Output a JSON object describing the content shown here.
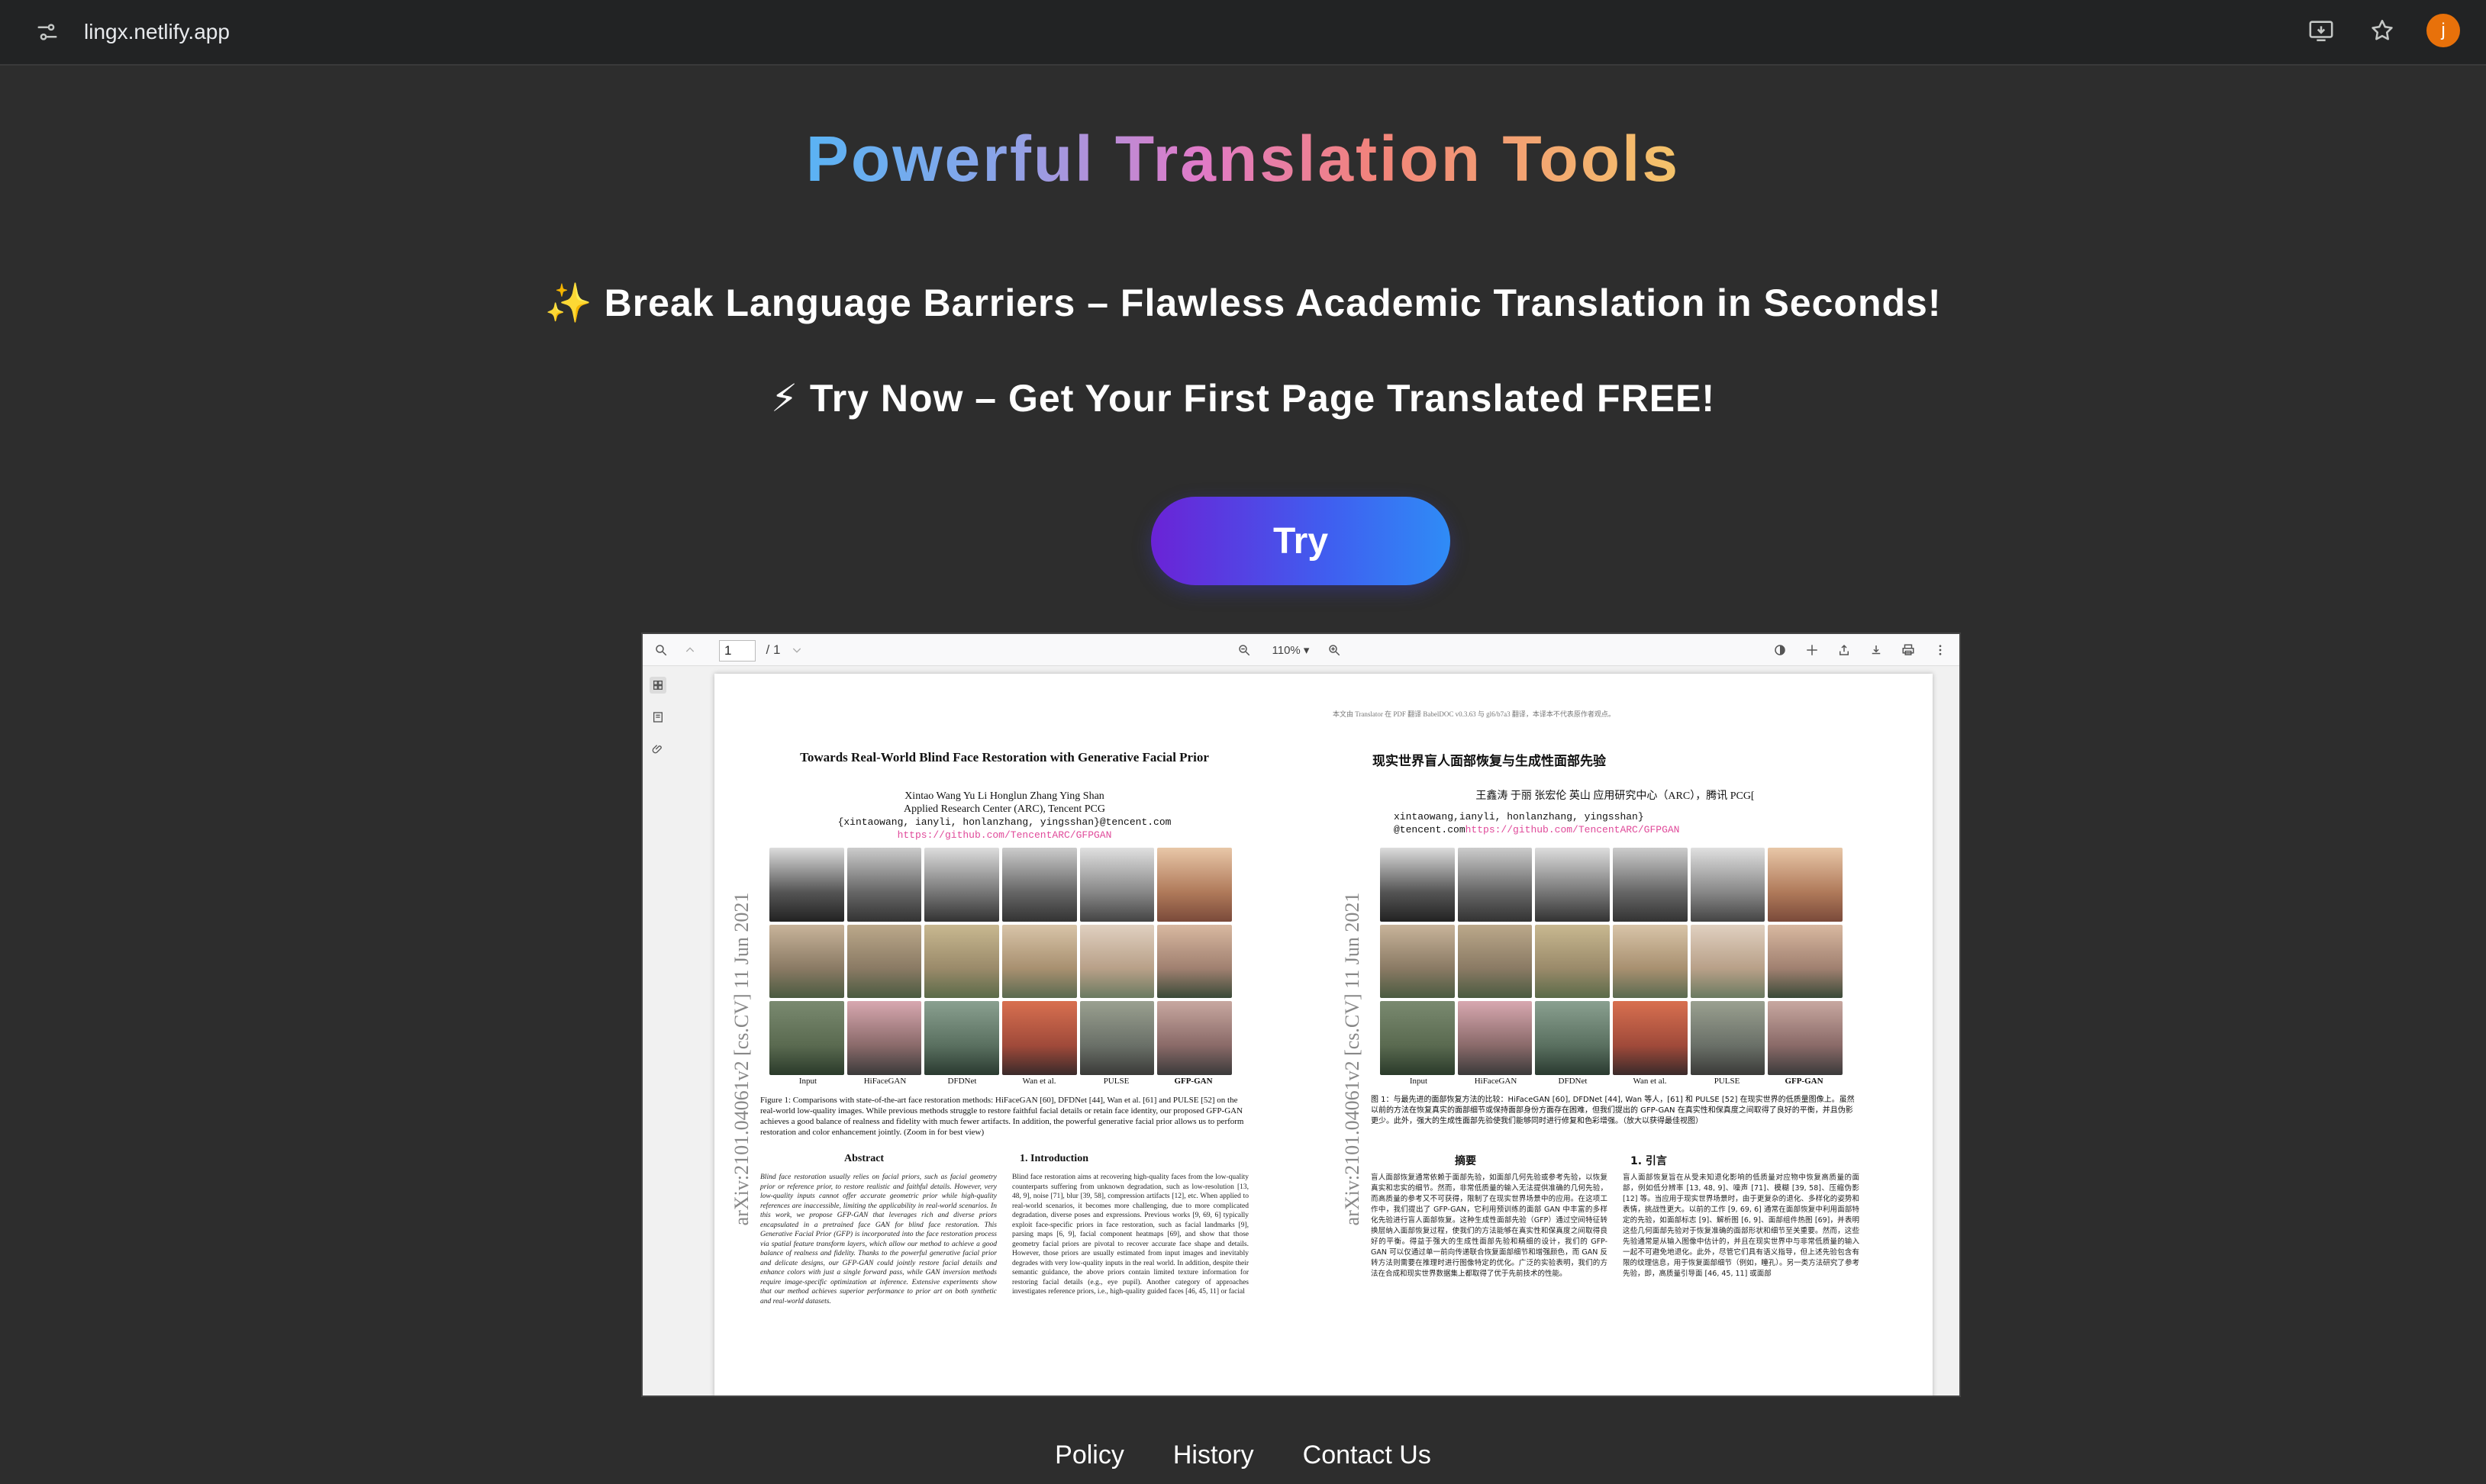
{
  "browser": {
    "url": "lingx.netlify.app",
    "avatar_initial": "j"
  },
  "hero": {
    "title": "Powerful Translation Tools",
    "tagline_1": "✨ Break Language Barriers – Flawless Academic Translation in Seconds!",
    "tagline_2": "⚡ Try Now – Get Your First Page Translated FREE!",
    "try_label": "Try"
  },
  "pdf_viewer": {
    "page_current": "1",
    "page_total": "/ 1",
    "zoom": "110% ▾",
    "english": {
      "title": "Towards Real-World Blind Face Restoration with Generative Facial Prior",
      "authors": "Xintao Wang    Yu Li    Honglun Zhang    Ying Shan",
      "affiliation": "Applied Research Center (ARC), Tencent PCG",
      "emails": "{xintaowang, ianyli, honlanzhang, yingsshan}@tencent.com",
      "link": "https://github.com/TencentARC/GFPGAN",
      "arxiv": "arXiv:2101.04061v2  [cs.CV]  11 Jun 2021",
      "face_labels": [
        "Input",
        "HiFaceGAN",
        "DFDNet",
        "Wan et al.",
        "PULSE",
        "GFP-GAN"
      ],
      "caption": "Figure 1: Comparisons with state-of-the-art face restoration methods: HiFaceGAN [60], DFDNet [44], Wan et al. [61] and PULSE [52] on the real-world low-quality images. While previous methods struggle to restore faithful facial details or retain face identity, our proposed GFP-GAN achieves a good balance of realness and fidelity with much fewer artifacts. In addition, the powerful generative facial prior allows us to perform restoration and color enhancement jointly. (Zoom in for best view)",
      "abstract_heading": "Abstract",
      "intro_heading": "1. Introduction",
      "abstract_text": "Blind face restoration usually relies on facial priors, such as facial geometry prior or reference prior, to restore realistic and faithful details. However, very low-quality inputs cannot offer accurate geometric prior while high-quality references are inaccessible, limiting the applicability in real-world scenarios. In this work, we propose GFP-GAN that leverages rich and diverse priors encapsulated in a pretrained face GAN for blind face restoration. This Generative Facial Prior (GFP) is incorporated into the face restoration process via spatial feature transform layers, which allow our method to achieve a good balance of realness and fidelity. Thanks to the powerful generative facial prior and delicate designs, our GFP-GAN could jointly restore facial details and enhance colors with just a single forward pass, while GAN inversion methods require image-specific optimization at inference. Extensive experiments show that our method achieves superior performance to prior art on both synthetic and real-world datasets.",
      "intro_text": "Blind face restoration aims at recovering high-quality faces from the low-quality counterparts suffering from unknown degradation, such as low-resolution [13, 48, 9], noise [71], blur [39, 58], compression artifacts [12], etc. When applied to real-world scenarios, it becomes more challenging, due to more complicated degradation, diverse poses and expressions. Previous works [9, 69, 6] typically exploit face-specific priors in face restoration, such as facial landmarks [9], parsing maps [6, 9], facial component heatmaps [69], and show that those geometry facial priors are pivotal to recover accurate face shape and details. However, those priors are usually estimated from input images and inevitably degrades with very low-quality inputs in the real world. In addition, despite their semantic guidance, the above priors contain limited texture information for restoring facial details (e.g., eye pupil). Another category of approaches investigates reference priors, i.e., high-quality guided faces [46, 45, 11] or facial"
    },
    "chinese": {
      "note": "本文由 Translator 在 PDF 翻译 BabelDOC v0.3.63 与 gl6/b7a3 翻译，本译本不代表原作者观点。",
      "title": "现实世界盲人面部恢复与生成性面部先验",
      "authors": "王鑫涛 于丽 张宏伦 英山 应用研究中心（ARC），腾讯 PCG[",
      "emails": "xintaowang,ianyli, honlanzhang, yingsshan}",
      "emails_2": "@tencent.com",
      "link": "https://github.com/TencentARC/GFPGAN",
      "arxiv": "arXiv:2101.04061v2  [cs.CV]  11 Jun 2021",
      "face_labels": [
        "Input",
        "HiFaceGAN",
        "DFDNet",
        "Wan et al.",
        "PULSE",
        "GFP-GAN"
      ],
      "caption": "图 1：与最先进的面部恢复方法的比较：HiFaceGAN [60], DFDNet [44], Wan 等人，[61] 和 PULSE [52] 在现实世界的低质量图像上。虽然以前的方法在恢复真实的面部细节或保持面部身份方面存在困难，但我们提出的 GFP-GAN 在真实性和保真度之间取得了良好的平衡，并且伪影更少。此外，强大的生成性面部先验使我们能够同时进行修复和色彩增强。（放大以获得最佳视图）",
      "abstract_heading": "摘要",
      "intro_heading": "1. 引言",
      "abstract_text": "盲人面部恢复通常依赖于面部先验，如面部几何先验或参考先验，以恢复真实和忠实的细节。然而，非常低质量的输入无法提供准确的几何先验，而高质量的参考又不可获得，限制了在现实世界场景中的应用。在这项工作中，我们提出了 GFP-GAN，它利用预训练的面部 GAN 中丰富的多样化先验进行盲人面部恢复。这种生成性面部先验（GFP）通过空间特征转换层纳入面部恢复过程，使我们的方法能够在真实性和保真度之间取得良好的平衡。得益于强大的生成性面部先验和精细的设计，我们的 GFP-GAN 可以仅通过单一前向传递联合恢复面部细节和增强颜色，而 GAN 反转方法则需要在推理时进行图像特定的优化。广泛的实验表明，我们的方法在合成和现实世界数据集上都取得了优于先前技术的性能。",
      "intro_text": "盲人面部恢复旨在从受未知退化影响的低质量对应物中恢复高质量的面部，例如低分辨率 [13, 48, 9]、噪声 [71]、模糊 [39, 58]、压缩伪影 [12] 等。当应用于现实世界场景时，由于更复杂的退化、多样化的姿势和表情，挑战性更大。以前的工作 [9, 69, 6] 通常在面部恢复中利用面部特定的先验，如面部标志 [9]、解析图 [6, 9]、面部组件热图 [69]，并表明这些几何面部先验对于恢复准确的面部形状和细节至关重要。然而，这些先验通常是从输入图像中估计的，并且在现实世界中与非常低质量的输入一起不可避免地退化。此外，尽管它们具有语义指导，但上述先验包含有限的纹理信息，用于恢复面部细节（例如，瞳孔）。另一类方法研究了参考先验，即，高质量引导面 [46, 45, 11] 或面部"
    }
  },
  "footer": {
    "links": [
      "Policy",
      "History",
      "Contact Us"
    ]
  },
  "colors": {
    "background": "#2d2d2d",
    "button_start": "#6a23d6",
    "button_end": "#2f8cf6",
    "avatar": "#e8710a",
    "link_pink": "#e04a9a"
  },
  "icons": {
    "site_info": "tune-icon",
    "install": "install-app-icon",
    "bookmark": "star-icon"
  }
}
